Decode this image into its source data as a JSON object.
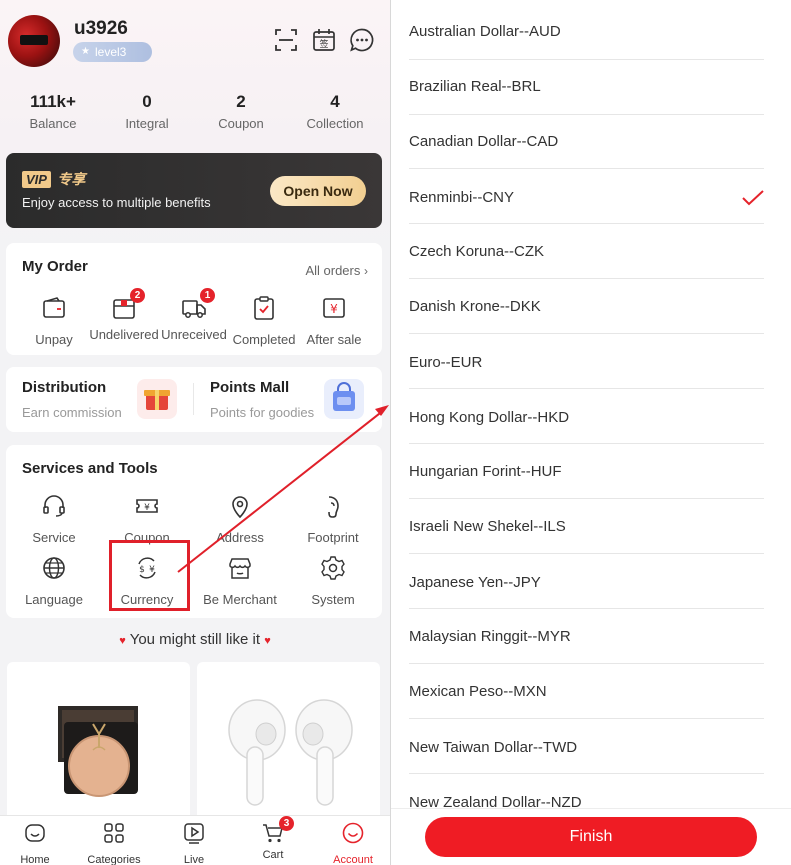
{
  "profile": {
    "username": "u3926",
    "level": "level3"
  },
  "stats": [
    {
      "value": "111k+",
      "label": "Balance"
    },
    {
      "value": "0",
      "label": "Integral"
    },
    {
      "value": "2",
      "label": "Coupon"
    },
    {
      "value": "4",
      "label": "Collection"
    }
  ],
  "vip": {
    "logo_text": "VIP",
    "logo_cn": "专享",
    "description": "Enjoy access to multiple benefits",
    "button": "Open Now"
  },
  "my_order": {
    "title": "My Order",
    "all_orders": "All orders",
    "items": [
      {
        "label": "Unpay",
        "icon": "wallet-icon",
        "badge": ""
      },
      {
        "label": "Undelivered",
        "icon": "package-icon",
        "badge": "2"
      },
      {
        "label": "Unreceived",
        "icon": "truck-icon",
        "badge": "1"
      },
      {
        "label": "Completed",
        "icon": "clipboard-check-icon",
        "badge": ""
      },
      {
        "label": "After sale",
        "icon": "yen-return-icon",
        "badge": ""
      }
    ]
  },
  "promo": {
    "distribution_title": "Distribution",
    "distribution_sub": "Earn commission",
    "mall_title": "Points Mall",
    "mall_sub": "Points for goodies"
  },
  "services": {
    "title": "Services and Tools",
    "items": [
      {
        "label": "Service",
        "icon": "headset-icon"
      },
      {
        "label": "Coupon",
        "icon": "coupon-icon"
      },
      {
        "label": "Address",
        "icon": "location-pin-icon"
      },
      {
        "label": "Footprint",
        "icon": "footprint-icon"
      },
      {
        "label": "Language",
        "icon": "globe-icon"
      },
      {
        "label": "Currency",
        "icon": "currency-exchange-icon"
      },
      {
        "label": "Be Merchant",
        "icon": "store-icon"
      },
      {
        "label": "System",
        "icon": "gear-icon"
      }
    ]
  },
  "recommend": {
    "title": "You might still like it"
  },
  "tabbar": [
    {
      "label": "Home",
      "icon": "home-icon",
      "badge": ""
    },
    {
      "label": "Categories",
      "icon": "grid-icon",
      "badge": ""
    },
    {
      "label": "Live",
      "icon": "play-icon",
      "badge": ""
    },
    {
      "label": "Cart",
      "icon": "cart-icon",
      "badge": "3"
    },
    {
      "label": "Account",
      "icon": "user-icon",
      "badge": ""
    }
  ],
  "currencies": [
    {
      "label": "Australian Dollar--AUD",
      "selected": false
    },
    {
      "label": "Brazilian Real--BRL",
      "selected": false
    },
    {
      "label": "Canadian Dollar--CAD",
      "selected": false
    },
    {
      "label": "Renminbi--CNY",
      "selected": true
    },
    {
      "label": "Czech Koruna--CZK",
      "selected": false
    },
    {
      "label": "Danish Krone--DKK",
      "selected": false
    },
    {
      "label": "Euro--EUR",
      "selected": false
    },
    {
      "label": "Hong Kong Dollar--HKD",
      "selected": false
    },
    {
      "label": "Hungarian Forint--HUF",
      "selected": false
    },
    {
      "label": "Israeli New Shekel--ILS",
      "selected": false
    },
    {
      "label": "Japanese Yen--JPY",
      "selected": false
    },
    {
      "label": "Malaysian Ringgit--MYR",
      "selected": false
    },
    {
      "label": "Mexican Peso--MXN",
      "selected": false
    },
    {
      "label": "New Taiwan Dollar--TWD",
      "selected": false
    },
    {
      "label": "New Zealand Dollar--NZD",
      "selected": false
    }
  ],
  "finish_button": "Finish",
  "colors": {
    "accent": "#ef1c24",
    "check": "#e5232b"
  }
}
